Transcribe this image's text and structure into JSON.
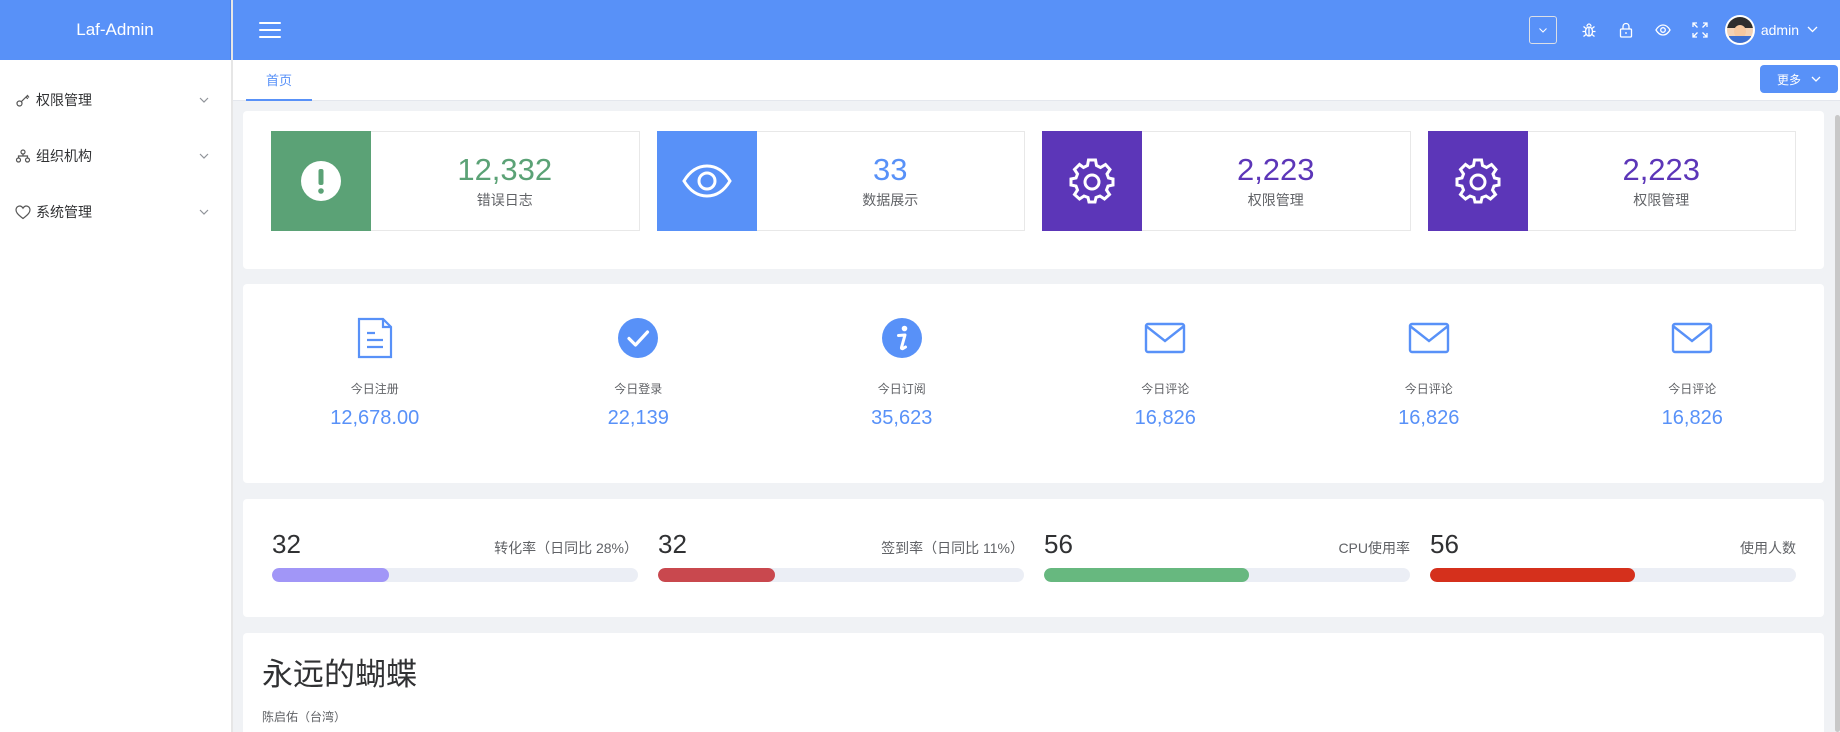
{
  "app": {
    "title": "Laf-Admin"
  },
  "sidebar": {
    "items": [
      {
        "label": "权限管理",
        "icon": "key-icon"
      },
      {
        "label": "组织机构",
        "icon": "org-icon"
      },
      {
        "label": "系统管理",
        "icon": "heart-icon"
      }
    ]
  },
  "header": {
    "user": "admin",
    "icons": [
      "bug-icon",
      "lock-icon",
      "eye-icon",
      "fullscreen-icon"
    ]
  },
  "tabs": {
    "items": [
      {
        "label": "首页"
      }
    ],
    "more_label": "更多"
  },
  "stats": [
    {
      "value": "12,332",
      "label": "错误日志",
      "color": "#5ba276",
      "icon": "alert-icon"
    },
    {
      "value": "33",
      "label": "数据展示",
      "color": "#5891f8",
      "icon": "eye-icon"
    },
    {
      "value": "2,223",
      "label": "权限管理",
      "color": "#5c36b8",
      "icon": "gear-icon"
    },
    {
      "value": "2,223",
      "label": "权限管理",
      "color": "#5c36b8",
      "icon": "gear-icon"
    }
  ],
  "today": [
    {
      "label": "今日注册",
      "value": "12,678.00",
      "icon": "document-icon"
    },
    {
      "label": "今日登录",
      "value": "22,139",
      "icon": "check-circle-icon"
    },
    {
      "label": "今日订阅",
      "value": "35,623",
      "icon": "info-icon"
    },
    {
      "label": "今日评论",
      "value": "16,826",
      "icon": "mail-icon"
    },
    {
      "label": "今日评论",
      "value": "16,826",
      "icon": "mail-icon"
    },
    {
      "label": "今日评论",
      "value": "16,826",
      "icon": "mail-icon"
    }
  ],
  "progress": [
    {
      "value": "32",
      "label": "转化率（日同比 28%）",
      "percent": 32,
      "color": "#a196f7"
    },
    {
      "value": "32",
      "label": "签到率（日同比 11%）",
      "percent": 32,
      "color": "#c9484e"
    },
    {
      "value": "56",
      "label": "CPU使用率",
      "percent": 56,
      "color": "#67b87f"
    },
    {
      "value": "56",
      "label": "使用人数",
      "percent": 56,
      "color": "#d5301c"
    }
  ],
  "song": {
    "title": "永远的蝴蝶",
    "artist": "陈启佑（台湾）"
  }
}
